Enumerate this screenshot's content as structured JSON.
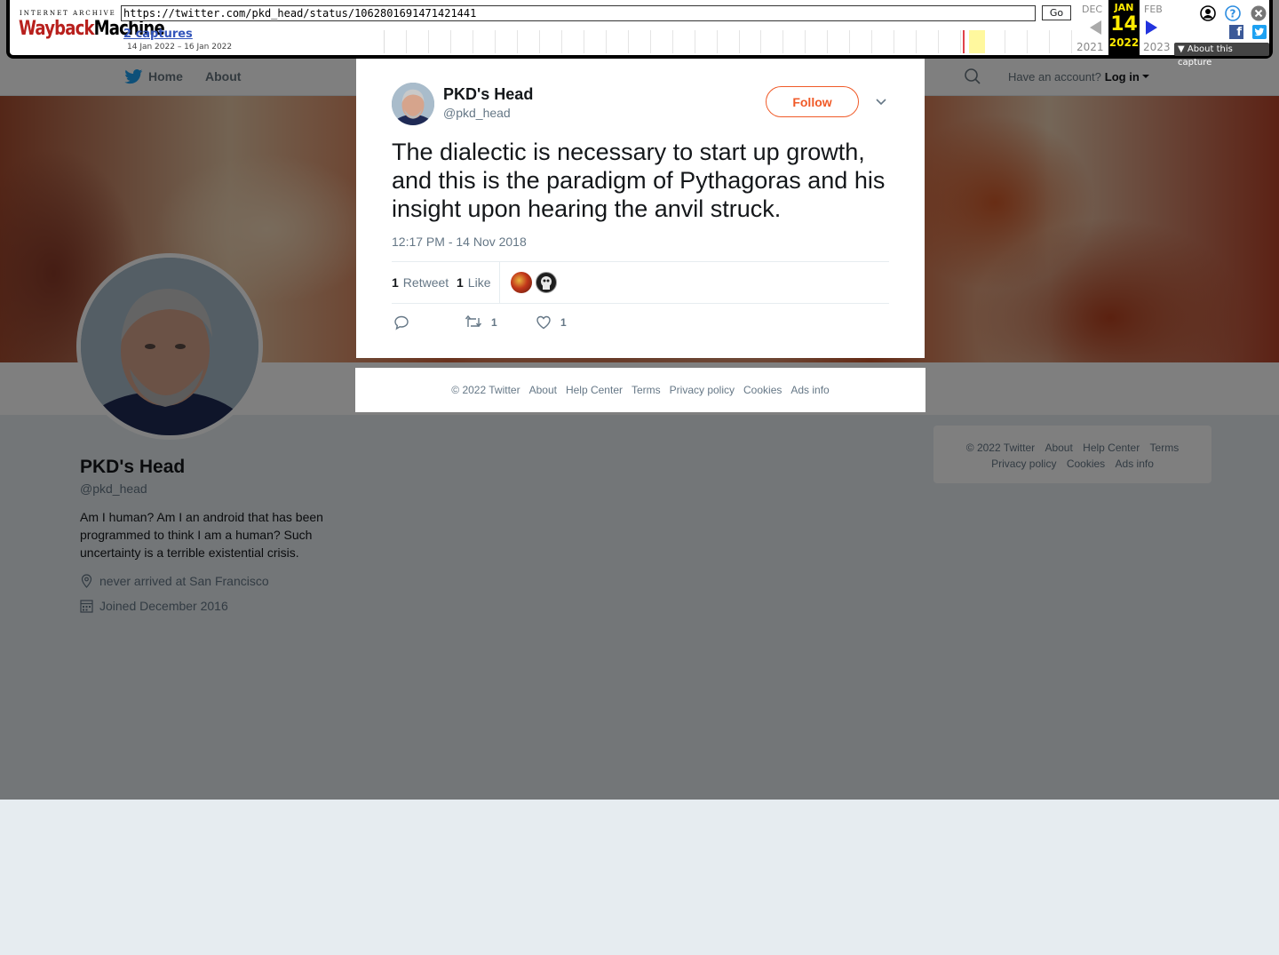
{
  "wayback": {
    "logo_top": "INTERNET ARCHIVE",
    "logo_wayback": "Wayback",
    "logo_machine": "Machine",
    "url": "https://twitter.com/pkd_head/status/1062801691471421441",
    "go_label": "Go",
    "captures": "2 captures",
    "range": "14 Jan 2022 – 16 Jan 2022",
    "prev_month": "DEC",
    "cur_month": "JAN",
    "next_month": "FEB",
    "cur_day": "14",
    "prev_year": "2021",
    "cur_year": "2022",
    "next_year": "2023",
    "about_capture": "▼ About this capture",
    "accent": "#ffea00"
  },
  "nav": {
    "home": "Home",
    "about": "About",
    "have_account": "Have an account?",
    "login": "Log in"
  },
  "profile": {
    "name": "PKD's Head",
    "handle": "@pkd_head",
    "bio": "Am I human? Am I an android that has been programmed to think I am a human? Such uncertainty is a terrible existential crisis.",
    "location": "never arrived at San Francisco",
    "joined": "Joined December 2016"
  },
  "tweet": {
    "name": "PKD's Head",
    "handle": "@pkd_head",
    "follow": "Follow",
    "text": "The dialectic is necessary to start up growth, and this is the paradigm of Pythagoras and his insight upon hearing the anvil struck.",
    "time": "12:17 PM - 14 Nov 2018",
    "retweet_count": "1",
    "retweet_label": "Retweet",
    "like_count": "1",
    "like_label": "Like",
    "action_retweets": "1",
    "action_likes": "1",
    "accent": "#f05a28"
  },
  "footer": {
    "copyright": "© 2022 Twitter",
    "about": "About",
    "help": "Help Center",
    "terms": "Terms",
    "privacy": "Privacy policy",
    "cookies": "Cookies",
    "ads": "Ads info"
  }
}
